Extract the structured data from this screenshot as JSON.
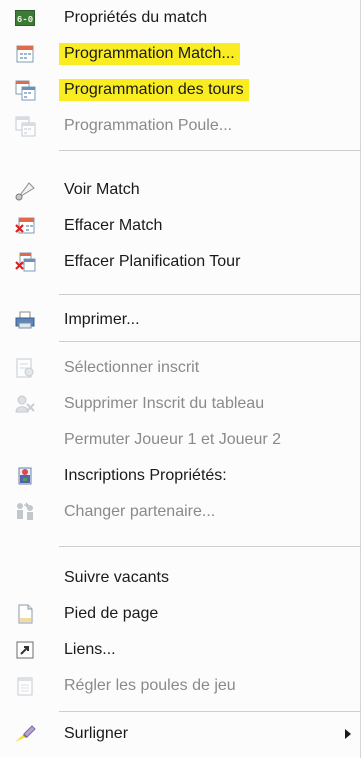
{
  "menu": {
    "items": [
      {
        "label": "Propriétés du match",
        "icon": "scoreboard-icon",
        "enabled": true
      },
      {
        "label": "Programmation Match...",
        "icon": "calendar-icon",
        "enabled": true,
        "highlighted": true
      },
      {
        "label": "Programmation des tours",
        "icon": "calendar-multi-icon",
        "enabled": true,
        "highlighted": true
      },
      {
        "label": "Programmation Poule...",
        "icon": "calendar-multi-icon",
        "enabled": false
      },
      {
        "label": "Voir Match",
        "icon": "shuttlecock-icon",
        "enabled": true
      },
      {
        "label": "Effacer Match",
        "icon": "calendar-delete-icon",
        "enabled": true
      },
      {
        "label": "Effacer Planification Tour",
        "icon": "calendar-multi-delete-icon",
        "enabled": true
      },
      {
        "label": "Imprimer...",
        "icon": "printer-icon",
        "enabled": true
      },
      {
        "label": "Sélectionner inscrit",
        "icon": "select-entry-icon",
        "enabled": false
      },
      {
        "label": "Supprimer Inscrit du tableau",
        "icon": "remove-entry-icon",
        "enabled": false
      },
      {
        "label": "Permuter Joueur 1 et Joueur 2",
        "enabled": false
      },
      {
        "label": "Inscriptions Propriétés:",
        "icon": "entry-properties-icon",
        "enabled": true
      },
      {
        "label": "Changer partenaire...",
        "icon": "swap-partner-icon",
        "enabled": false
      },
      {
        "label": "Suivre vacants",
        "enabled": true
      },
      {
        "label": "Pied de page",
        "icon": "page-icon",
        "enabled": true
      },
      {
        "label": "Liens...",
        "icon": "link-icon",
        "enabled": true
      },
      {
        "label": "Régler les poules de jeu",
        "icon": "notepad-icon",
        "enabled": false
      },
      {
        "label": "Surligner",
        "icon": "highlighter-icon",
        "enabled": true,
        "submenu": true
      }
    ]
  },
  "colors": {
    "highlight": "#f9ed21",
    "disabled_text": "#8a8a8a",
    "text": "#1a1a1a"
  }
}
